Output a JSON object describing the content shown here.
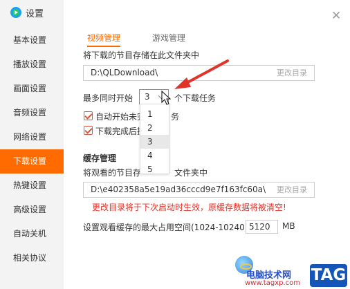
{
  "app": {
    "title": "设置",
    "logo_icon": "qq-video-logo-icon"
  },
  "sidebar": {
    "items": [
      {
        "label": "基本设置",
        "active": false
      },
      {
        "label": "播放设置",
        "active": false
      },
      {
        "label": "画面设置",
        "active": false
      },
      {
        "label": "音频设置",
        "active": false
      },
      {
        "label": "网络设置",
        "active": false
      },
      {
        "label": "下载设置",
        "active": true
      },
      {
        "label": "热键设置",
        "active": false
      },
      {
        "label": "高级设置",
        "active": false
      },
      {
        "label": "自动关机",
        "active": false
      },
      {
        "label": "相关协议",
        "active": false
      }
    ]
  },
  "tabs": [
    {
      "label": "视频管理",
      "active": true
    },
    {
      "label": "游戏管理",
      "active": false
    }
  ],
  "download": {
    "folder_label": "将下载的节目存储在此文件夹中",
    "folder_path": "D:\\QLDownload\\",
    "change_dir": "更改目录",
    "max_tasks_prefix": "最多同时开始",
    "max_tasks_suffix": "个下载任务",
    "max_tasks_value": "3",
    "max_tasks_options": [
      "1",
      "2",
      "3",
      "4",
      "5"
    ],
    "highlighted_option": "3",
    "auto_start_label": "自动开始未完成的任务",
    "auto_start_visible": "自动开始未完",
    "auto_start_tail": "务",
    "finish_label": "下载完成后提示",
    "finish_visible": "下载完成后提"
  },
  "cache": {
    "section_title": "缓存管理",
    "folder_label_visible": "将观看的节目存",
    "folder_label_tail": "文件夹中",
    "folder_path": "D:\\e402358a5e19ad36cccd9e7f163fc60a\\",
    "change_dir": "更改目录",
    "warning": "更改目录将于下次启动时生效，原缓存数据将被清空!",
    "max_space_label": "设置观看缓存的最大占用空间(1024-10240)",
    "max_space_value": "5120",
    "unit": "MB"
  },
  "watermark": {
    "site_name": "电脑技术网",
    "url": "www.tagxp.com",
    "tag": "TAG"
  },
  "colors": {
    "accent": "#ff6b00",
    "warning": "#e0332a",
    "annotation_arrow": "#e0332a"
  }
}
